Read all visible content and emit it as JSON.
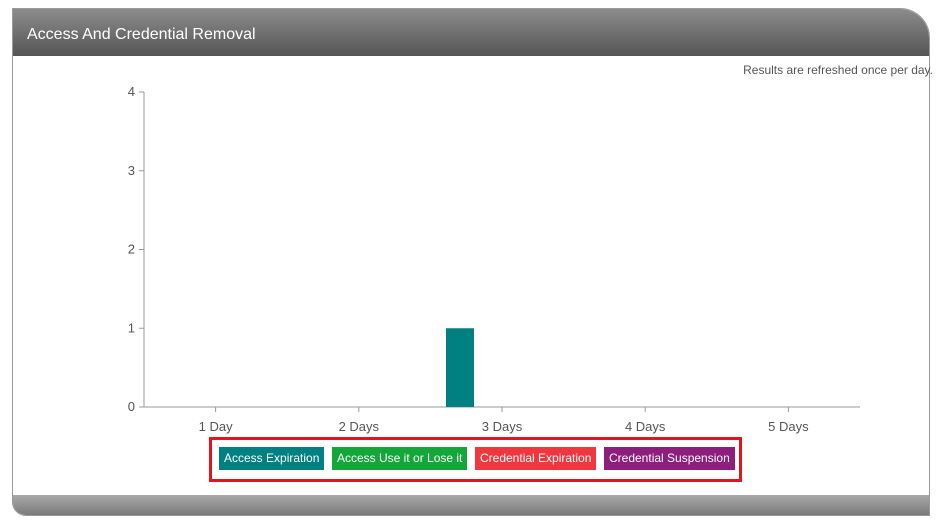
{
  "panel": {
    "title": "Access And Credential Removal",
    "refresh_note": "Results are refreshed once per day."
  },
  "colors": {
    "access_expiration": "#008080",
    "access_use_it_or_lose_it": "#13a73a",
    "credential_expiration": "#f0373f",
    "credential_suspension": "#8e1e7c",
    "highlight_box": "#e0151f"
  },
  "chart_data": {
    "type": "bar",
    "title": "",
    "xlabel": "",
    "ylabel": "",
    "categories": [
      "1 Day",
      "2 Days",
      "3 Days",
      "4 Days",
      "5 Days"
    ],
    "ylim": [
      0,
      4
    ],
    "yticks": [
      0,
      1,
      2,
      3,
      4
    ],
    "grid": false,
    "legend_position": "bottom",
    "series": [
      {
        "name": "Access Expiration",
        "color": "#008080",
        "values": [
          0,
          0,
          1,
          0,
          0
        ]
      },
      {
        "name": "Access Use it or Lose it",
        "color": "#13a73a",
        "values": [
          0,
          0,
          0,
          0,
          0
        ]
      },
      {
        "name": "Credential Expiration",
        "color": "#f0373f",
        "values": [
          0,
          0,
          0,
          0,
          0
        ]
      },
      {
        "name": "Credential Suspension",
        "color": "#8e1e7c",
        "values": [
          0,
          0,
          0,
          0,
          0
        ]
      }
    ]
  },
  "legend": {
    "items": [
      {
        "label": "Access Expiration"
      },
      {
        "label": "Access Use it or Lose it"
      },
      {
        "label": "Credential Expiration"
      },
      {
        "label": "Credential Suspension"
      }
    ]
  }
}
